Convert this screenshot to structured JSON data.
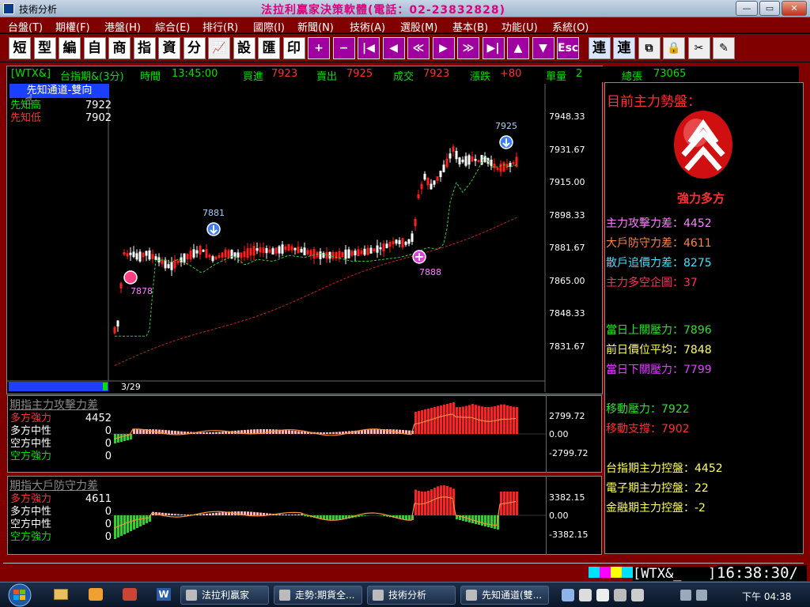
{
  "window": {
    "title": "技術分析",
    "banner": "法拉利贏家決策軟體(電話：02-23832828)",
    "controls": {
      "minimize": "—",
      "maximize": "▭",
      "close": "✕"
    }
  },
  "menu": [
    "台盤(T)",
    "期權(F)",
    "港盤(H)",
    "綜合(E)",
    "排行(R)",
    "國際(I)",
    "新聞(N)",
    "技術(A)",
    "選股(M)",
    "基本(B)",
    "功能(U)",
    "系統(O)"
  ],
  "toolbar": {
    "text_buttons": [
      "短",
      "型",
      "編",
      "自",
      "商",
      "指",
      "資",
      "分"
    ],
    "text_buttons2": [
      "設",
      "匯",
      "印"
    ],
    "symbol_buttons": [
      "+",
      "−",
      "|◀",
      "◀",
      "≪",
      "▶",
      "≫",
      "▶|",
      "▲",
      "▼",
      "Esc"
    ],
    "right_buttons": [
      "連",
      "連",
      "⧉",
      "🔒",
      "✂",
      "✎"
    ]
  },
  "quote": {
    "symbol": "[WTX&]",
    "name": "台指期&(3分)",
    "time_label": "時間",
    "time": "13:45:00",
    "buy_label": "買進",
    "buy": "7923",
    "sell_label": "賣出",
    "sell": "7925",
    "deal_label": "成交",
    "deal": "7923",
    "change_label": "漲跌",
    "change": "+80",
    "volume_label": "單量",
    "volume": "2",
    "total_label": "總張",
    "total": "73065"
  },
  "main_chart": {
    "channel_label": "先知通道-雙向",
    "high_label": "先知高",
    "high_value": "7922",
    "low_label": "先知低",
    "low_value": "7902",
    "date": "3/29",
    "y_ticks": [
      "7948.33",
      "7931.67",
      "7915.00",
      "7898.33",
      "7881.67",
      "7865.00",
      "7848.33",
      "7831.67"
    ],
    "markers": [
      "7925",
      "7881",
      "7878",
      "7888"
    ]
  },
  "panel2": {
    "title": "期指主力攻擊力差",
    "rows": [
      {
        "label": "多方強力",
        "value": "4452"
      },
      {
        "label": "多方中性",
        "value": "0"
      },
      {
        "label": "空方中性",
        "value": "0"
      },
      {
        "label": "空方強力",
        "value": "0"
      }
    ],
    "y_ticks": [
      "2799.72",
      "0.00",
      "-2799.72"
    ]
  },
  "panel3": {
    "title": "期指大戶防守力差",
    "rows": [
      {
        "label": "多方強力",
        "value": "4611"
      },
      {
        "label": "多方中性",
        "value": "0"
      },
      {
        "label": "空方中性",
        "value": "0"
      },
      {
        "label": "空方強力",
        "value": "0"
      }
    ],
    "y_ticks": [
      "3382.15",
      "0.00",
      "-3382.15"
    ]
  },
  "info": {
    "header": "目前主力勢盤：",
    "status": "強力多方",
    "lines": [
      {
        "text": "主力攻擊力差：4452"
      },
      {
        "text": "大戶防守力差：4611"
      },
      {
        "text": "散戶追價力差：8275"
      },
      {
        "text": "主力多空企圖：37"
      },
      {
        "text": "當日上關壓力：7896"
      },
      {
        "text": "前日價位平均：7848"
      },
      {
        "text": "當日下關壓力：7799"
      },
      {
        "text": "移動壓力：7922"
      },
      {
        "text": "移動支撐：7902"
      },
      {
        "text": "台指期主力控盤：4452"
      },
      {
        "text": "電子期主力控盤：22"
      },
      {
        "text": "金融期主力控盤：-2"
      }
    ]
  },
  "status": {
    "symbol": "[WTX&_",
    "bracket": "]",
    "clock": "16:38:30/"
  },
  "taskbar": {
    "tasks": [
      "法拉利贏家",
      "走勢:期貨全...",
      "技術分析",
      "先知通道(雙..."
    ],
    "time": "下午 04:38"
  },
  "colors": {
    "frame": "#800000",
    "up": "#ff2020",
    "down": "#ffffff",
    "ma_green": "#30d030",
    "ma_red": "#d02020"
  }
}
